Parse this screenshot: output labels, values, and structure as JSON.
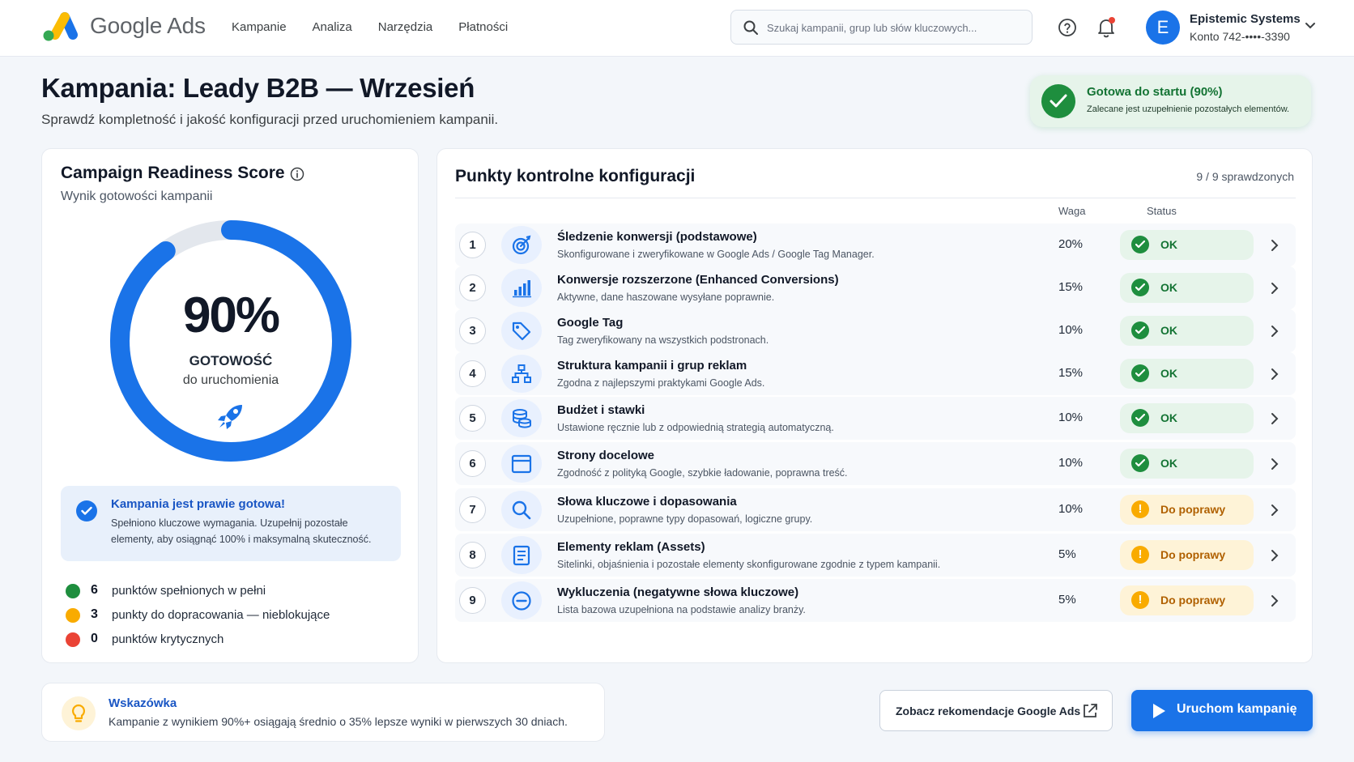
{
  "header": {
    "brand": "Google Ads",
    "nav": [
      "Kampanie",
      "Analiza",
      "Narzędzia",
      "Płatności"
    ],
    "search_placeholder": "Szukaj kampanii, grup lub słów kluczowych...",
    "account": {
      "initial": "E",
      "name": "Epistemic Systems",
      "sub": "Konto 742-••••-3390"
    }
  },
  "page": {
    "title": "Kampania: Leady B2B — Wrzesień",
    "subtitle": "Sprawdź kompletność i jakość konfiguracji przed uruchomieniem kampanii."
  },
  "ready_badge": {
    "title": "Gotowa do startu (90%)",
    "sub": "Zalecane jest uzupełnienie pozostałych elementów."
  },
  "score": {
    "title": "Campaign Readiness Score",
    "subtitle": "Wynik gotowości kampanii",
    "percent_label": "90%",
    "value": 0.9,
    "label": "GOTOWOŚĆ",
    "sublabel": "do uruchomienia",
    "note_title": "Kampania jest prawie gotowa!",
    "note_text": "Spełniono kluczowe wymagania. Uzupełnij pozostałe elementy, aby osiągnąć 100% i maksymalną skuteczność.",
    "legend": [
      {
        "count": "6",
        "text": "punktów spełnionych w pełni",
        "color": "#1e8e3e"
      },
      {
        "count": "3",
        "text": "punkty do dopracowania — nieblokujące",
        "color": "#f9ab00"
      },
      {
        "count": "0",
        "text": "punktów krytycznych",
        "color": "#ea4335"
      }
    ]
  },
  "checklist": {
    "title": "Punkty kontrolne konfiguracji",
    "count": "9 / 9 sprawdzonych",
    "col_weight": "Waga",
    "col_status": "Status",
    "items": [
      {
        "num": "1",
        "icon": "target-icon",
        "title": "Śledzenie konwersji (podstawowe)",
        "desc": "Skonfigurowane i zweryfikowane w Google Ads / Google Tag Manager.",
        "weight": "20%",
        "status": "OK",
        "state": "ok"
      },
      {
        "num": "2",
        "icon": "bar-chart-icon",
        "title": "Konwersje rozszerzone (Enhanced Conversions)",
        "desc": "Aktywne, dane haszowane wysyłane poprawnie.",
        "weight": "15%",
        "status": "OK",
        "state": "ok"
      },
      {
        "num": "3",
        "icon": "tag-icon",
        "title": "Google Tag",
        "desc": "Tag zweryfikowany na wszystkich podstronach.",
        "weight": "10%",
        "status": "OK",
        "state": "ok"
      },
      {
        "num": "4",
        "icon": "hierarchy-icon",
        "title": "Struktura kampanii i grup reklam",
        "desc": "Zgodna z najlepszymi praktykami Google Ads.",
        "weight": "15%",
        "status": "OK",
        "state": "ok"
      },
      {
        "num": "5",
        "icon": "coins-icon",
        "title": "Budżet i stawki",
        "desc": "Ustawione ręcznie lub z odpowiednią strategią automatyczną.",
        "weight": "10%",
        "status": "OK",
        "state": "ok"
      },
      {
        "num": "6",
        "icon": "browser-window-icon",
        "title": "Strony docelowe",
        "desc": "Zgodność z polityką Google, szybkie ładowanie, poprawna treść.",
        "weight": "10%",
        "status": "OK",
        "state": "ok"
      },
      {
        "num": "7",
        "icon": "search-icon",
        "title": "Słowa kluczowe i dopasowania",
        "desc": "Uzupełnione, poprawne typy dopasowań, logiczne grupy.",
        "weight": "10%",
        "status": "Do poprawy",
        "state": "warn"
      },
      {
        "num": "8",
        "icon": "document-icon",
        "title": "Elementy reklam (Assets)",
        "desc": "Sitelinki, objaśnienia i pozostałe elementy skonfigurowane zgodnie z typem kampanii.",
        "weight": "5%",
        "status": "Do poprawy",
        "state": "warn"
      },
      {
        "num": "9",
        "icon": "minus-circle-icon",
        "title": "Wykluczenia (negatywne słowa kluczowe)",
        "desc": "Lista bazowa uzupełniona na podstawie analizy branży.",
        "weight": "5%",
        "status": "Do poprawy",
        "state": "warn"
      }
    ]
  },
  "tip": {
    "title": "Wskazówka",
    "text": "Kampanie z wynikiem 90%+ osiągają średnio o 35% lepsze wyniki w pierwszych 30 dniach."
  },
  "actions": {
    "recommendations": "Zobacz rekomendacje Google Ads",
    "launch": "Uruchom kampanię"
  },
  "colors": {
    "accent": "#1a73e8",
    "ok": "#1e8e3e",
    "warn": "#f9ab00",
    "critical": "#ea4335"
  }
}
